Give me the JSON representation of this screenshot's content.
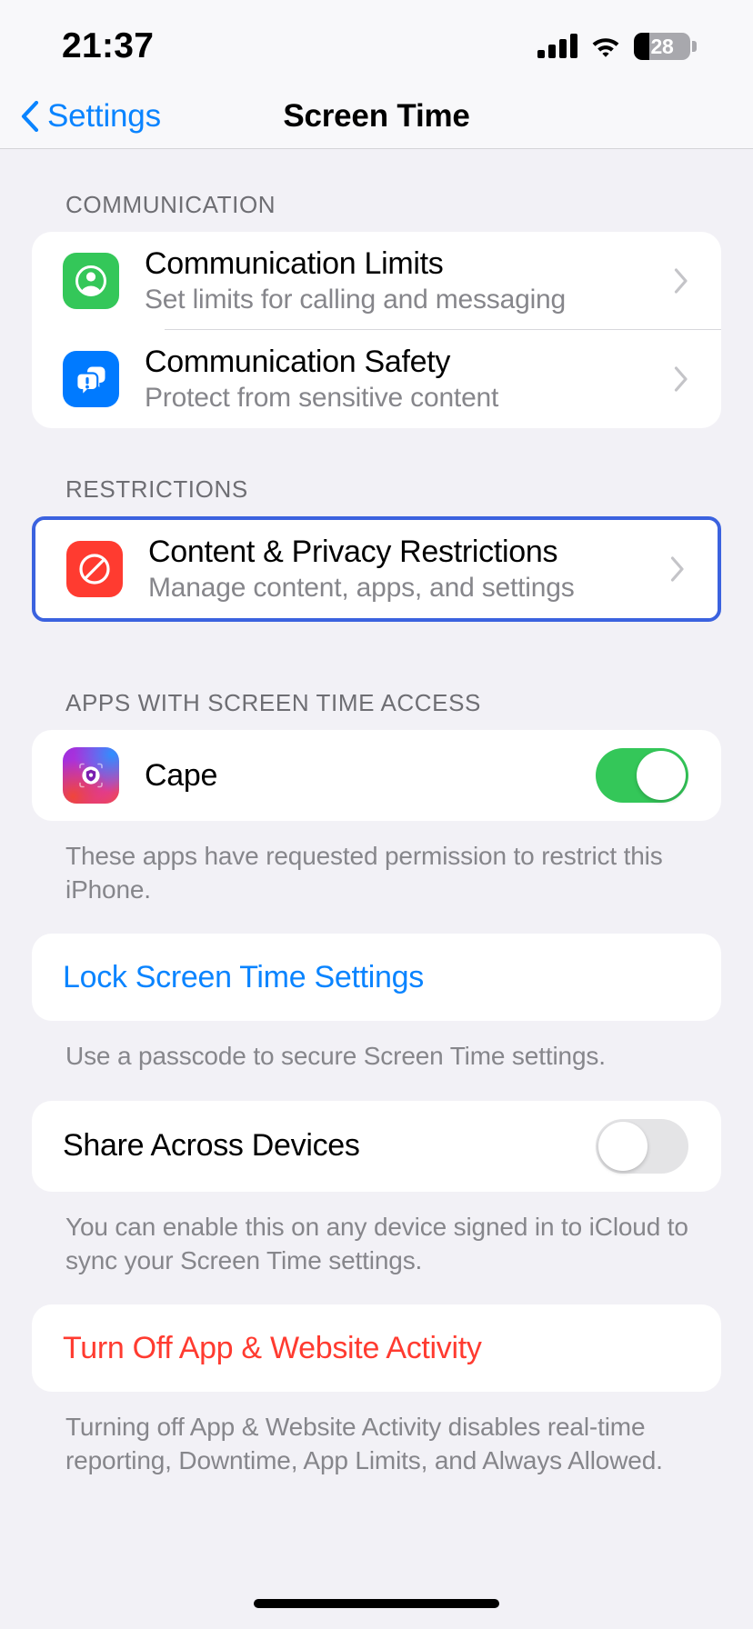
{
  "status_bar": {
    "time": "21:37",
    "battery_level": "28",
    "battery_percent": 28,
    "signal_icon": "cellular-signal-icon",
    "wifi_icon": "wifi-icon"
  },
  "nav": {
    "back_label": "Settings",
    "title": "Screen Time"
  },
  "sections": {
    "communication": {
      "header": "COMMUNICATION",
      "rows": [
        {
          "title": "Communication Limits",
          "subtitle": "Set limits for calling and messaging",
          "icon": "person-circle-icon",
          "icon_color": "#34c759"
        },
        {
          "title": "Communication Safety",
          "subtitle": "Protect from sensitive content",
          "icon": "message-bubbles-warning-icon",
          "icon_color": "#007aff"
        }
      ]
    },
    "restrictions": {
      "header": "RESTRICTIONS",
      "highlighted": true,
      "highlight_color": "#3b62df",
      "rows": [
        {
          "title": "Content & Privacy Restrictions",
          "subtitle": "Manage content, apps, and settings",
          "icon": "no-entry-icon",
          "icon_color": "#ff3b30"
        }
      ]
    },
    "apps_access": {
      "header": "APPS WITH SCREEN TIME ACCESS",
      "rows": [
        {
          "title": "Cape",
          "icon": "cape-app-icon",
          "toggle_state": "on"
        }
      ],
      "footnote": "These apps have requested permission to restrict this iPhone."
    },
    "lock_settings": {
      "label": "Lock Screen Time Settings",
      "label_color": "#0a84ff",
      "footnote": "Use a passcode to secure Screen Time settings."
    },
    "share_devices": {
      "label": "Share Across Devices",
      "toggle_state": "off",
      "footnote": "You can enable this on any device signed in to iCloud to sync your Screen Time settings."
    },
    "turn_off": {
      "label": "Turn Off App & Website Activity",
      "label_color": "#ff3b30",
      "footnote": "Turning off App & Website Activity disables real-time reporting, Downtime, App Limits, and Always Allowed."
    }
  }
}
